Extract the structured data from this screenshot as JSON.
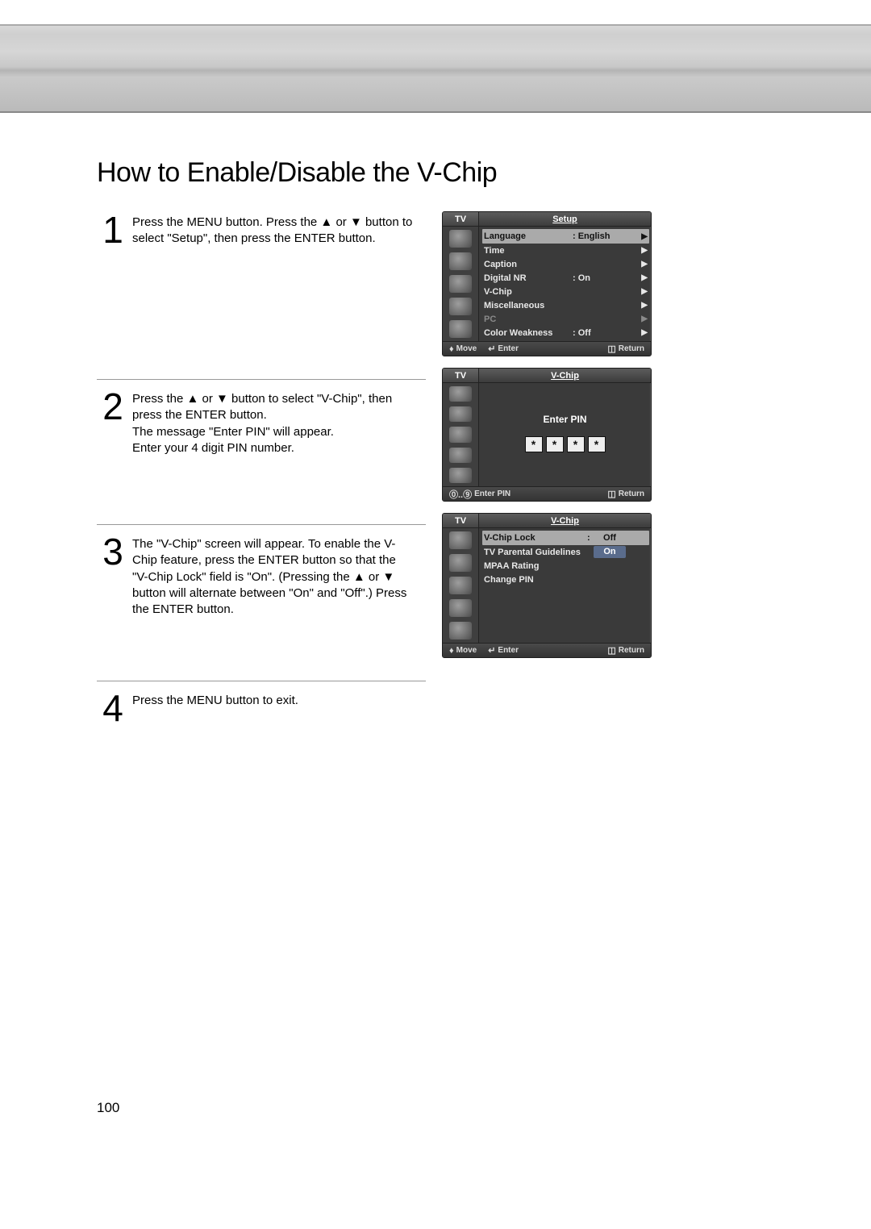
{
  "page_number": "100",
  "heading": "How to Enable/Disable the V-Chip",
  "steps": {
    "s1": {
      "num": "1",
      "text": "Press the MENU button. Press the ▲ or ▼ button to select \"Setup\", then press the ENTER button."
    },
    "s2": {
      "num": "2",
      "text": "Press the ▲ or ▼ button to select \"V-Chip\", then press the ENTER button.\nThe message \"Enter PIN\" will appear.\nEnter your 4 digit PIN number."
    },
    "s3": {
      "num": "3",
      "text": "The \"V-Chip\" screen will appear. To enable the V-Chip feature, press the ENTER button so that the \"V-Chip Lock\" field is \"On\". (Pressing the ▲ or ▼ button will alternate between \"On\" and \"Off\".) Press the ENTER button."
    },
    "s4": {
      "num": "4",
      "text": "Press the MENU button to exit."
    }
  },
  "osd_common": {
    "tv": "TV",
    "foot_move": "Move",
    "foot_enter": "Enter",
    "foot_return": "Return",
    "foot_enter_pin": "Enter PIN",
    "arrow": "▶"
  },
  "osd1": {
    "title": "Setup",
    "items": [
      {
        "label": "Language",
        "value": ":  English",
        "arrow": true,
        "sel": true
      },
      {
        "label": "Time",
        "value": "",
        "arrow": true
      },
      {
        "label": "Caption",
        "value": "",
        "arrow": true
      },
      {
        "label": "Digital NR",
        "value": ":  On",
        "arrow": true
      },
      {
        "label": "V-Chip",
        "value": "",
        "arrow": true
      },
      {
        "label": "Miscellaneous",
        "value": "",
        "arrow": true
      },
      {
        "label": "PC",
        "value": "",
        "arrow": true,
        "disabled": true
      },
      {
        "label": "Color Weakness",
        "value": ":  Off",
        "arrow": true
      }
    ]
  },
  "osd2": {
    "title": "V-Chip",
    "enter_pin_label": "Enter PIN",
    "pin": [
      "*",
      "*",
      "*",
      "*"
    ]
  },
  "osd3": {
    "title": "V-Chip",
    "items": [
      {
        "label": "V-Chip Lock",
        "sep": ":",
        "pill": "Off",
        "pill_style": "plain",
        "sel": true
      },
      {
        "label": "TV Parental Guidelines",
        "sep": "",
        "pill": "On",
        "pill_style": "on"
      },
      {
        "label": "MPAA Rating",
        "sep": "",
        "pill": ""
      },
      {
        "label": "Change PIN",
        "sep": "",
        "pill": ""
      }
    ]
  }
}
